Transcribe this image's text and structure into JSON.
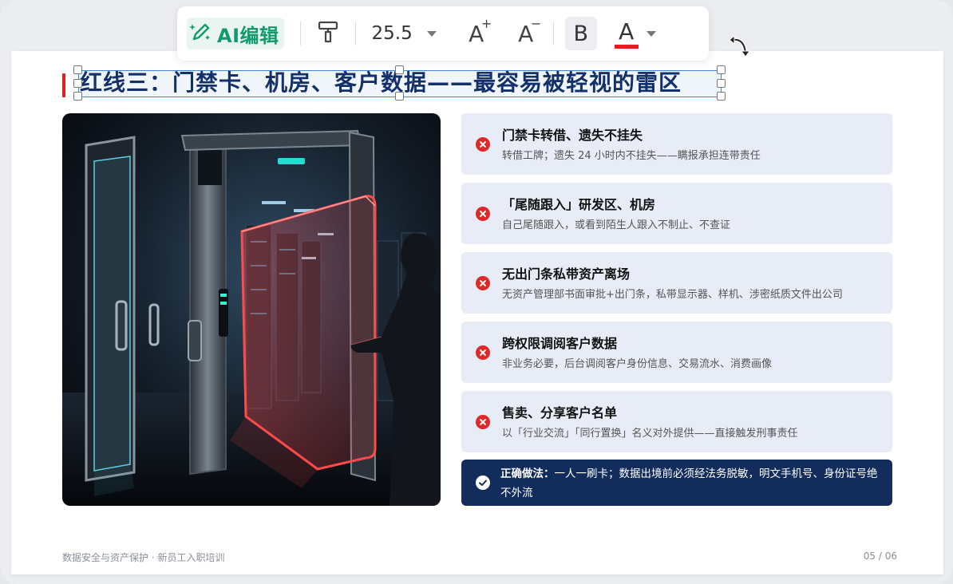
{
  "toolbar": {
    "ai_edit_label": "AI编辑",
    "font_size": "25.5",
    "increase_font_label": "A",
    "decrease_font_label": "A",
    "bold_label": "B",
    "text_color_label": "A",
    "text_color": "#e02020"
  },
  "slide": {
    "title": "红线三：门禁卡、机房、客户数据——最容易被轻视的雷区",
    "accent_color": "#e02020",
    "items": [
      {
        "title": "门禁卡转借、遗失不挂失",
        "desc": "转借工牌；遗失 24 小时内不挂失——瞒报承担连带责任"
      },
      {
        "title": "「尾随跟入」研发区、机房",
        "desc": "自己尾随跟入，或看到陌生人跟入不制止、不查证"
      },
      {
        "title": "无出门条私带资产离场",
        "desc": "无资产管理部书面审批+出门条，私带显示器、样机、涉密纸质文件出公司"
      },
      {
        "title": "跨权限调阅客户数据",
        "desc": "非业务必要，后台调阅客户身份信息、交易流水、消费画像"
      },
      {
        "title": "售卖、分享客户名单",
        "desc": "以「行业交流」「同行置换」名义对外提供——直接触发刑事责任"
      }
    ],
    "tip": {
      "label": "正确做法：",
      "text": "一人一刷卡；数据出境前必须经法务脱敏，明文手机号、身份证号绝不外流"
    },
    "footer_left": "数据安全与资产保护 · 新员工入职培训",
    "footer_right": "05 / 06"
  }
}
